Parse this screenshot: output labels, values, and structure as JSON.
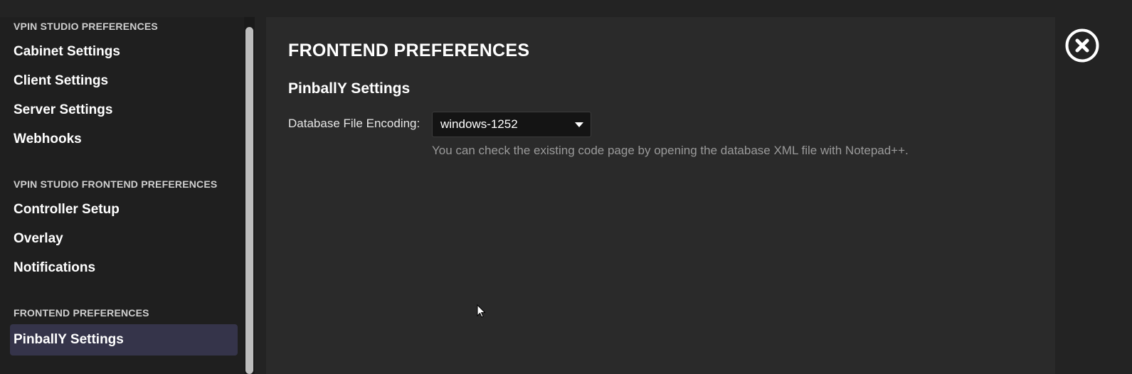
{
  "sidebar": {
    "sections": [
      {
        "title": "VPIN STUDIO PREFERENCES",
        "items": [
          "Cabinet Settings",
          "Client Settings",
          "Server Settings",
          "Webhooks"
        ]
      },
      {
        "title": "VPIN STUDIO FRONTEND PREFERENCES",
        "items": [
          "Controller Setup",
          "Overlay",
          "Notifications"
        ]
      },
      {
        "title": "FRONTEND PREFERENCES",
        "items": [
          "PinballY Settings"
        ]
      }
    ],
    "selected_item": "PinballY Settings"
  },
  "main": {
    "page_title": "FRONTEND PREFERENCES",
    "section_title": "PinballY Settings",
    "encoding_field": {
      "label": "Database File Encoding:",
      "value": "windows-1252",
      "hint": "You can check the existing code page by opening the database XML file with Notepad++."
    }
  },
  "icons": {
    "close": "close-circle-icon",
    "dropdown": "chevron-down-icon",
    "cursor": "mouse-pointer-icon"
  },
  "colors": {
    "background": "#232323",
    "sidebar_background": "#1f1f1f",
    "panel_background": "#2a2a2a",
    "selected_item_background": "#35344a",
    "hint_text": "#9a9a9a"
  }
}
